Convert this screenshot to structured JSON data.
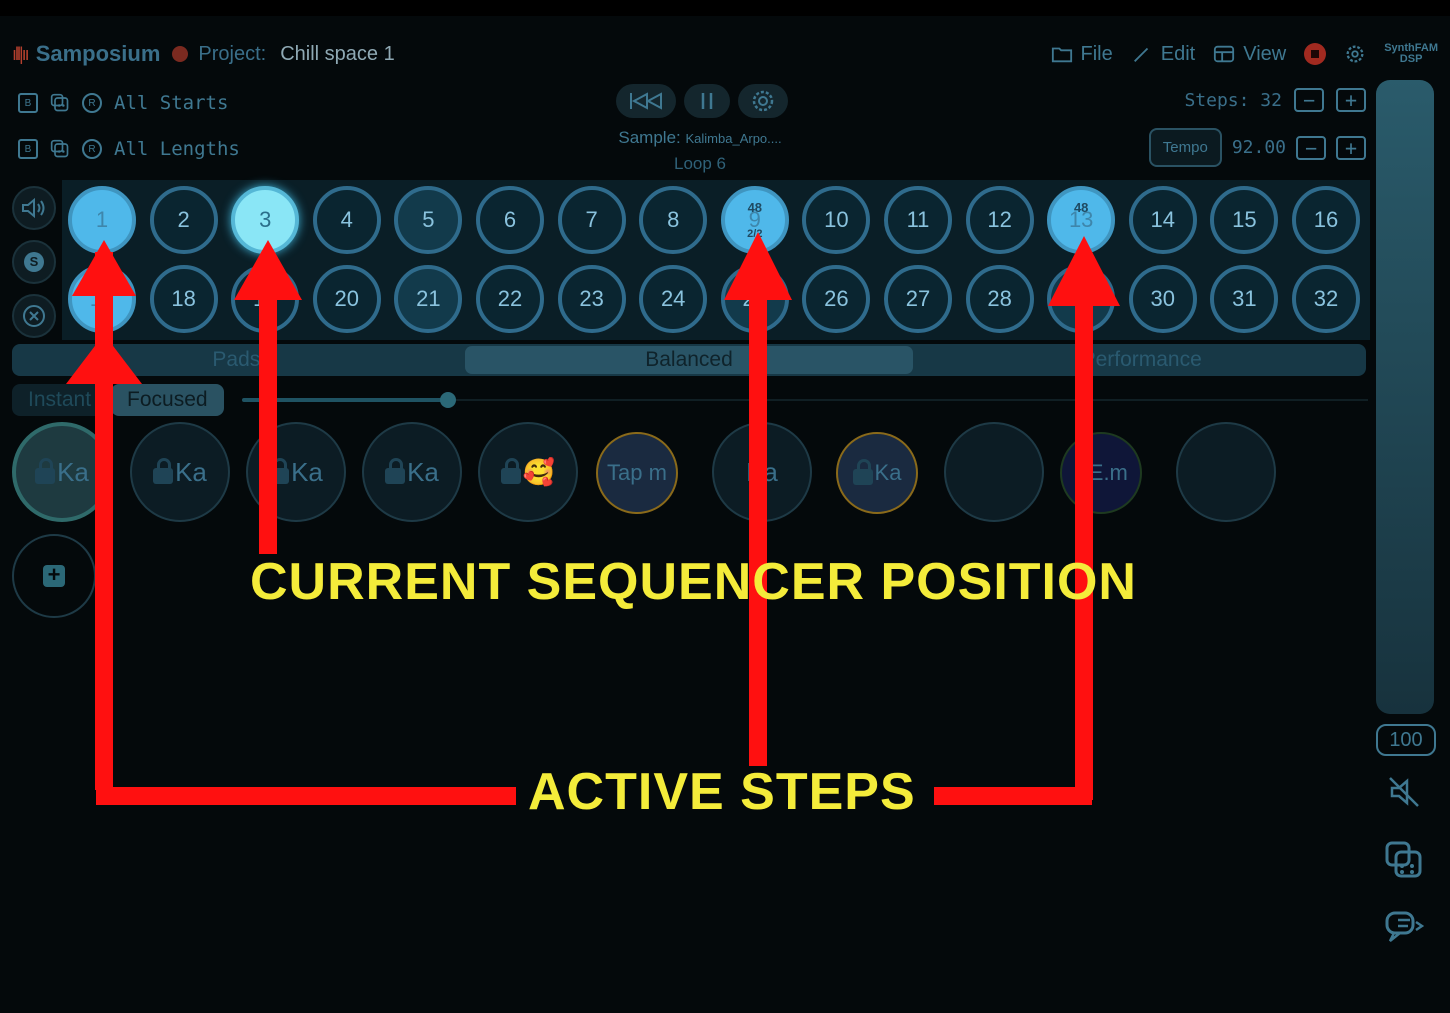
{
  "app": {
    "name": "Samposium",
    "project_label": "Project:",
    "project_name": "Chill space 1"
  },
  "menu": {
    "file": "File",
    "edit": "Edit",
    "view": "View",
    "brand_top": "SynthFAM",
    "brand_bottom": "DSP"
  },
  "rows": {
    "b_label": "B",
    "r_label": "R",
    "starts_label": "All Starts",
    "lengths_label": "All Lengths"
  },
  "transport": {
    "sample_label": "Sample:",
    "sample_name": "Kalimba_Arpo....",
    "loop_label": "Loop 6"
  },
  "steps": {
    "label": "Steps: 32",
    "value": 32
  },
  "tempo": {
    "button": "Tempo",
    "value": "92.00"
  },
  "left_icons": {
    "s_label": "S"
  },
  "pads": {
    "row1": [
      {
        "label": "1",
        "state": "lit"
      },
      {
        "label": "2",
        "state": "off"
      },
      {
        "label": "3",
        "state": "current"
      },
      {
        "label": "4",
        "state": "off"
      },
      {
        "label": "5",
        "state": "dim"
      },
      {
        "label": "6",
        "state": "off"
      },
      {
        "label": "7",
        "state": "off"
      },
      {
        "label": "8",
        "state": "off"
      },
      {
        "label": "9",
        "state": "lit",
        "top": "48",
        "bottom": "2/2"
      },
      {
        "label": "10",
        "state": "off"
      },
      {
        "label": "11",
        "state": "off"
      },
      {
        "label": "12",
        "state": "off"
      },
      {
        "label": "13",
        "state": "lit",
        "top": "48"
      },
      {
        "label": "14",
        "state": "off"
      },
      {
        "label": "15",
        "state": "off"
      },
      {
        "label": "16",
        "state": "off"
      }
    ],
    "row2": [
      {
        "label": "17",
        "state": "lit"
      },
      {
        "label": "18",
        "state": "off"
      },
      {
        "label": "19",
        "state": "off"
      },
      {
        "label": "20",
        "state": "off"
      },
      {
        "label": "21",
        "state": "dim"
      },
      {
        "label": "22",
        "state": "off"
      },
      {
        "label": "23",
        "state": "off"
      },
      {
        "label": "24",
        "state": "off"
      },
      {
        "label": "25",
        "state": "dim"
      },
      {
        "label": "26",
        "state": "off"
      },
      {
        "label": "27",
        "state": "off"
      },
      {
        "label": "28",
        "state": "off"
      },
      {
        "label": "29",
        "state": "dim"
      },
      {
        "label": "30",
        "state": "off"
      },
      {
        "label": "31",
        "state": "off"
      },
      {
        "label": "32",
        "state": "off"
      }
    ]
  },
  "tabs": {
    "pads": "Pads",
    "balanced": "Balanced",
    "performance": "Performance"
  },
  "modes": {
    "instant": "Instant",
    "focused": "Focused"
  },
  "sample_pads": [
    "Ka",
    "Ka",
    "Ka",
    "Ka",
    "🥰",
    "Tap m",
    "Ka",
    "Ka",
    "",
    "BE.m",
    ""
  ],
  "volume": {
    "value": "100"
  },
  "annotations": {
    "current": "CURRENT SEQUENCER POSITION",
    "active": "ACTIVE STEPS"
  },
  "colors": {
    "accent": "#4fb8ea",
    "current_step": "#8ae6f6",
    "annotation_text": "#f4ec3a",
    "arrow": "#ff1010",
    "record": "#a12a20"
  }
}
